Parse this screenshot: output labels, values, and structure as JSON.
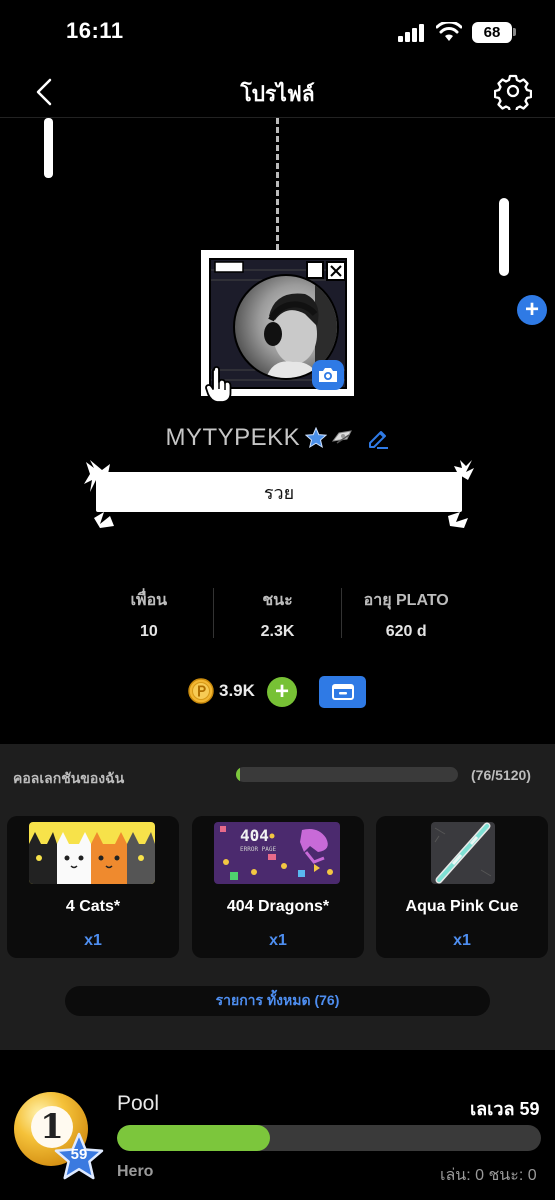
{
  "status": {
    "time": "16:11",
    "battery": "68"
  },
  "nav": {
    "title": "โปรไฟล์",
    "back_icon": "chevron-left-icon",
    "settings_icon": "gear-icon"
  },
  "profile": {
    "username": "MYTYPEKK",
    "bio": "รวย",
    "badges": [
      "star-icon",
      "ship-icon"
    ]
  },
  "stats": [
    {
      "label": "เพื่อน",
      "value": "10"
    },
    {
      "label": "ชนะ",
      "value": "2.3K"
    },
    {
      "label": "อายุ PLATO",
      "value": "620 d"
    }
  ],
  "wallet": {
    "coins": "3.9K"
  },
  "collection": {
    "title": "คอลเลกชันของฉัน",
    "count": "(76/5120)",
    "progress": 0.015,
    "items": [
      {
        "name": "4 Cats*",
        "qty": "x1"
      },
      {
        "name": "404 Dragons*",
        "qty": "x1"
      },
      {
        "name": "Aqua Pink Cue",
        "qty": "x1"
      }
    ],
    "item_404_art_text": "404",
    "item_404_art_sub": "ERROR PAGE",
    "all_label": "รายการ ทั้งหมด (76)"
  },
  "game": {
    "name": "Pool",
    "level": "เลเวล 59",
    "level_badge": "59",
    "ball_number": "1",
    "title": "Hero",
    "record": "เล่น: 0 ชนะ: 0",
    "progress": 0.36
  },
  "colors": {
    "accent_blue": "#2f7ae5",
    "green": "#7cc63c",
    "link_blue": "#4e8ef0",
    "panel": "#1e1e1e"
  }
}
